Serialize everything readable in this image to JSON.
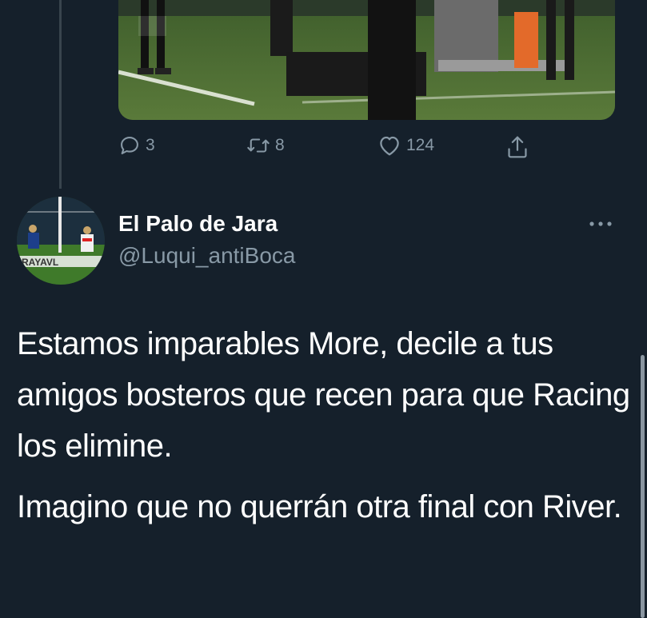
{
  "previous_tweet": {
    "media": {
      "alt": "photo"
    },
    "actions": {
      "reply_count": "3",
      "retweet_count": "8",
      "like_count": "124"
    }
  },
  "tweet": {
    "display_name": "El Palo de Jara",
    "handle": "@Luqui_antiBoca",
    "paragraphs": [
      "Estamos imparables More, decile a tus amigos bosteros que recen para que Racing los elimine.",
      "Imagino que no querrán otra final con River."
    ]
  },
  "colors": {
    "background": "#15202b",
    "secondary_text": "#8899a6",
    "thread_line": "#38444d"
  },
  "icons": {
    "reply": "reply-icon",
    "retweet": "retweet-icon",
    "like": "heart-icon",
    "share": "share-icon",
    "more": "more-icon"
  }
}
